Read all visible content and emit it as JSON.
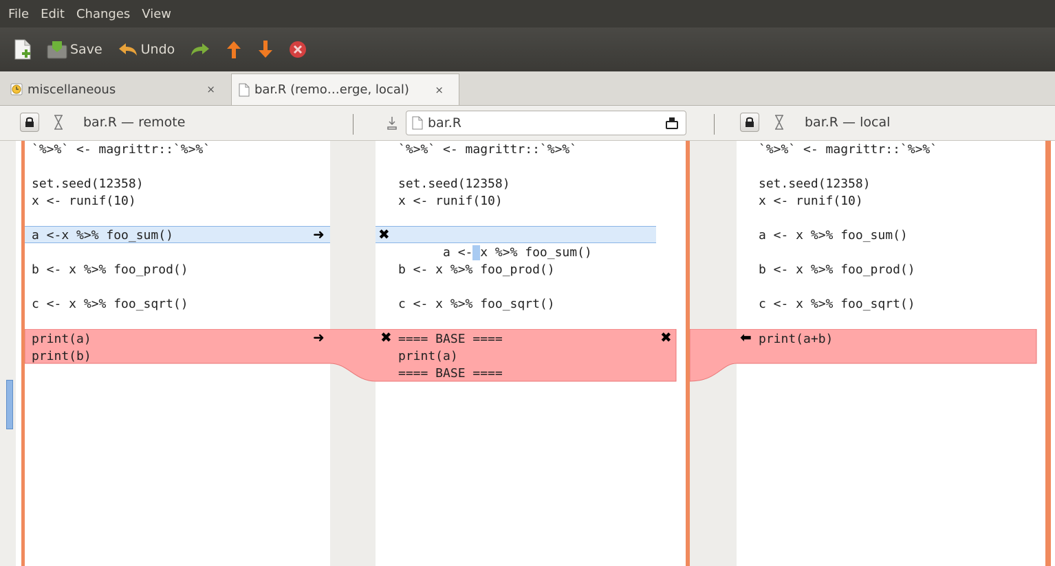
{
  "menu": [
    "File",
    "Edit",
    "Changes",
    "View"
  ],
  "toolbar": {
    "save_label": "Save",
    "undo_label": "Undo"
  },
  "tabs": [
    {
      "label": "miscellaneous",
      "close": "×"
    },
    {
      "label": "bar.R (remo…erge, local)",
      "close": "×"
    }
  ],
  "panes": {
    "left_title": "bar.R — remote",
    "middle_file": "bar.R",
    "right_title": "bar.R — local"
  },
  "code": {
    "line_magrittr": "`%>%` <- magrittr::`%>%`",
    "line_seed": "set.seed(12358)",
    "line_runif": "x <- runif(10)",
    "left_a": "a <-x %>% foo_sum()",
    "mid_a_1": "a <- ",
    "mid_a_2": "x %>% foo_sum()",
    "right_a": "a <- x %>% foo_sum()",
    "line_b": "b <- x %>% foo_prod()",
    "line_c": "c <- x %>% foo_sqrt()",
    "left_print": "print(a)\nprint(b)",
    "mid_print": "==== BASE ====\nprint(a)\n==== BASE ====",
    "right_print": "print(a+b)"
  },
  "colors": {
    "conflict": "#ffa7a7",
    "change": "#dbeafa",
    "accent_orange": "#f08a5d"
  }
}
